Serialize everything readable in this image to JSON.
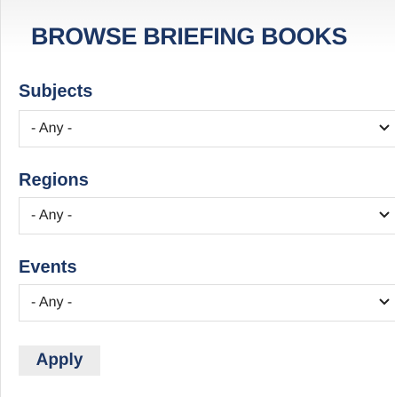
{
  "panel": {
    "title": "BROWSE BRIEFING BOOKS"
  },
  "filters": [
    {
      "label": "Subjects",
      "value": "- Any -",
      "icon": "chevron-down-icon"
    },
    {
      "label": "Regions",
      "value": "- Any -",
      "icon": "chevron-down-icon"
    },
    {
      "label": "Events",
      "value": "- Any -",
      "icon": "chevron-down-icon"
    }
  ],
  "apply_label": "Apply",
  "colors": {
    "heading": "#1c3664",
    "button_bg": "#ececec",
    "border": "#dedede"
  }
}
